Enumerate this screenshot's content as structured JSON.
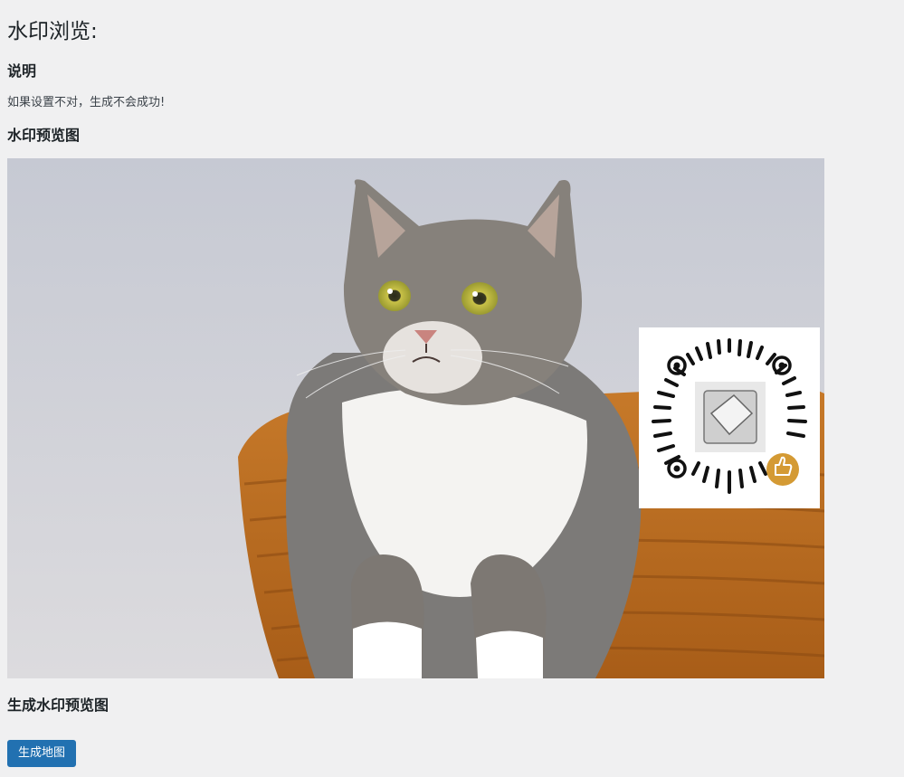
{
  "page": {
    "title": "水印浏览:"
  },
  "description": {
    "heading": "说明",
    "text": "如果设置不对，生成不会成功!"
  },
  "preview": {
    "heading": "水印预览图",
    "image_icon": "cat-photo-image",
    "watermark_icon": "qr-code-icon",
    "watermark_badge_color": "#d49a34"
  },
  "generate": {
    "heading": "生成水印预览图",
    "button_label": "生成地图",
    "button_color": "#2271b1"
  }
}
